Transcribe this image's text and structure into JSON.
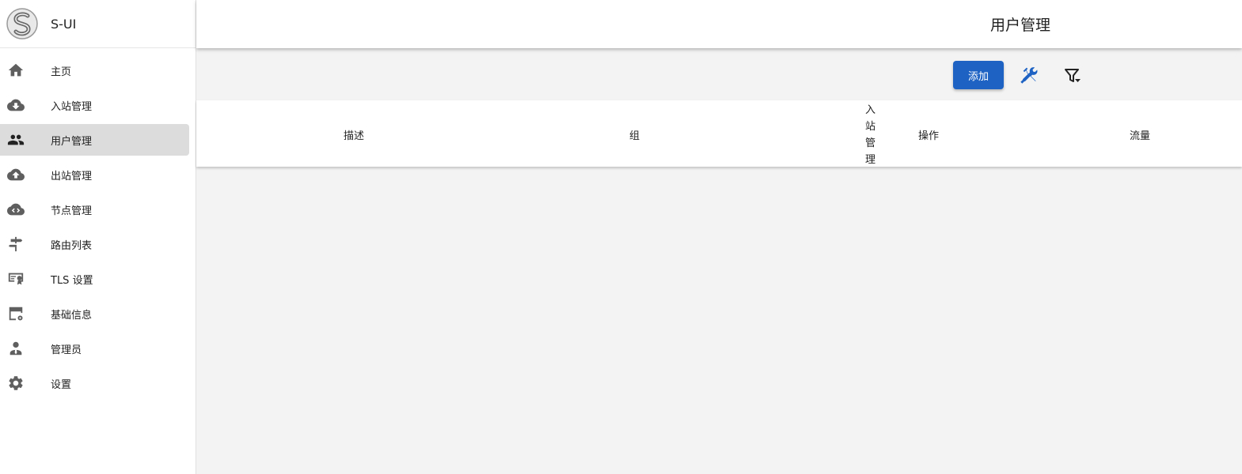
{
  "app": {
    "name": "S-UI"
  },
  "sidebar": {
    "items": [
      {
        "label": "主页",
        "icon": "home-icon"
      },
      {
        "label": "入站管理",
        "icon": "cloud-download-icon"
      },
      {
        "label": "用户管理",
        "icon": "users-icon",
        "active": true
      },
      {
        "label": "出站管理",
        "icon": "cloud-upload-icon"
      },
      {
        "label": "节点管理",
        "icon": "cloud-code-icon"
      },
      {
        "label": "路由列表",
        "icon": "signpost-icon"
      },
      {
        "label": "TLS 设置",
        "icon": "certificate-icon"
      },
      {
        "label": "基础信息",
        "icon": "calendar-settings-icon"
      },
      {
        "label": "管理员",
        "icon": "admin-user-icon"
      },
      {
        "label": "设置",
        "icon": "gear-icon"
      }
    ]
  },
  "header": {
    "title": "用户管理"
  },
  "toolbar": {
    "add_label": "添加",
    "tools_icon": "wrench-screwdriver-icon",
    "filter_icon": "filter-dropdown-icon"
  },
  "table": {
    "columns": [
      "描述",
      "组",
      "入站管理",
      "操作",
      "流量"
    ]
  },
  "colors": {
    "accent": "#1e63c4",
    "sidebar_active": "#dcdcdc",
    "background": "#f3f3f3"
  }
}
